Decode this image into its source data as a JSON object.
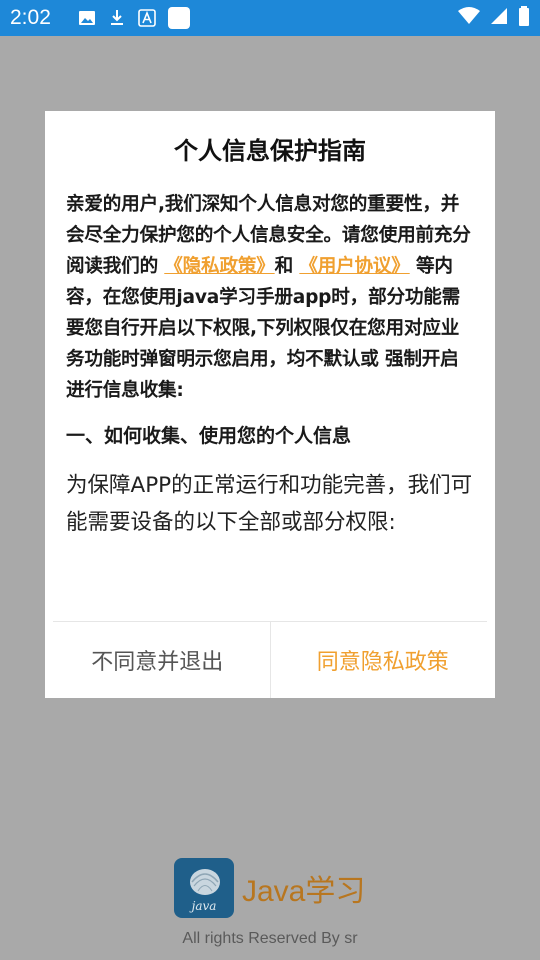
{
  "status_bar": {
    "time": "2:02",
    "icons": [
      "image-icon",
      "download-icon",
      "text-a-icon",
      "square-icon",
      "wifi-icon",
      "signal-icon",
      "battery-icon"
    ]
  },
  "dialog": {
    "title": "个人信息保护指南",
    "intro_part1": "亲爱的用户,我们深知个人信息对您的重要性，并会尽全力保护您的个人信息安全。请您使用前充分阅读我们的",
    "privacy_link": "《隐私政策》",
    "and_text": "和",
    "user_link": "《用户协议》",
    "intro_part2": "等内容，在您使用java学习手册app时，部分功能需要您自行开启以下权限,下列权限仅在您用对应业务功能时弹窗明示您启用，均不默认或 强制开启进行信息收集:",
    "section_heading": "一、如何收集、使用您的个人信息",
    "section_text": "为保障APP的正常运行和功能完善，我们可能需要设备的以下全部或部分权限:",
    "decline_button": "不同意并退出",
    "agree_button": "同意隐私政策"
  },
  "background": {
    "app_name": "Java学习",
    "logo_text": "java",
    "copyright": "All rights Reserved By sr"
  },
  "colors": {
    "status_bar": "#1e88d8",
    "overlay": "#a9a9a9",
    "accent": "#f0a030",
    "brand_text": "#b8761f"
  }
}
